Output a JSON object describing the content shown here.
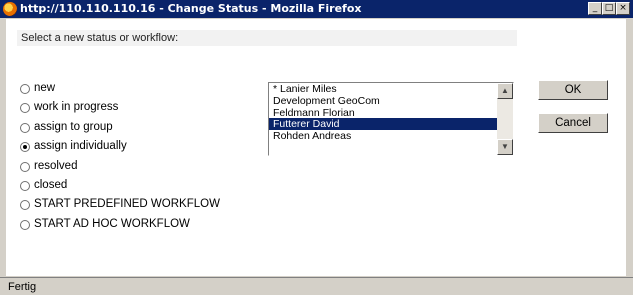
{
  "window": {
    "title": "http://110.110.110.16 - Change Status - Mozilla Firefox",
    "icon": "firefox-icon",
    "controls": [
      "minimize-icon",
      "maximize-icon",
      "close-icon"
    ]
  },
  "prompt": "Select a new status or workflow:",
  "statuses": [
    {
      "label": "new",
      "checked": false
    },
    {
      "label": "work in progress",
      "checked": false
    },
    {
      "label": "assign to group",
      "checked": false
    },
    {
      "label": "assign individually",
      "checked": true
    },
    {
      "label": "resolved",
      "checked": false
    },
    {
      "label": "closed",
      "checked": false
    },
    {
      "label": "START PREDEFINED WORKFLOW",
      "checked": false
    },
    {
      "label": "START AD HOC WORKFLOW",
      "checked": false
    }
  ],
  "assignees": {
    "items": [
      "* Lanier Miles",
      "Development GeoCom",
      "Feldmann Florian",
      "Futterer David",
      "Rohden Andreas"
    ],
    "selected": "Futterer David"
  },
  "buttons": {
    "ok": "OK",
    "cancel": "Cancel"
  },
  "status_bar": {
    "text": "Fertig"
  },
  "colors": {
    "selection": "#0a246a",
    "titlebar": "#0a246a",
    "window_bg": "#d4d0c8"
  }
}
